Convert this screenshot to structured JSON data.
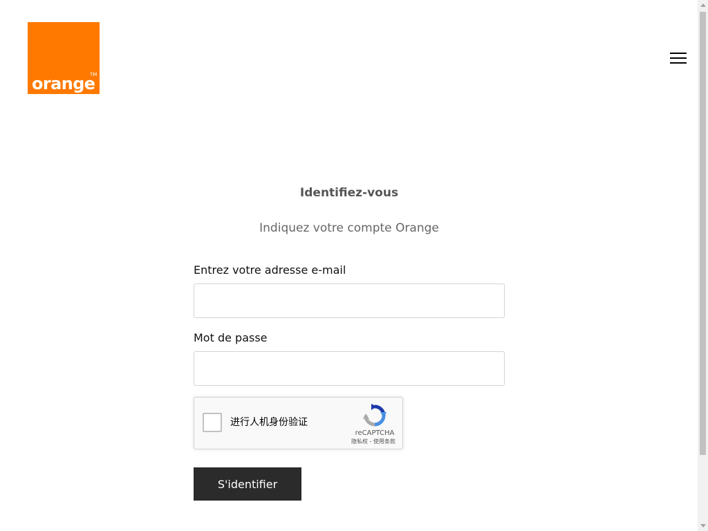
{
  "brand": {
    "logo_text": "orange",
    "logo_trademark": "TM",
    "logo_color": "#ff7900"
  },
  "header": {
    "menu_icon": "hamburger-menu-icon"
  },
  "form": {
    "title": "Identifiez-vous",
    "subtitle": "Indiquez votre compte Orange",
    "email": {
      "label": "Entrez votre adresse e-mail",
      "value": "",
      "placeholder": ""
    },
    "password": {
      "label": "Mot de passe",
      "value": "",
      "placeholder": ""
    },
    "recaptcha": {
      "checkbox_label": "进行人机身份验证",
      "brand": "reCAPTCHA",
      "terms": "隐私权 - 使用条款",
      "checked": false,
      "icon": "recaptcha-logo-icon"
    },
    "submit_label": "S'identifier",
    "submit_color": "#2b2b2b"
  }
}
